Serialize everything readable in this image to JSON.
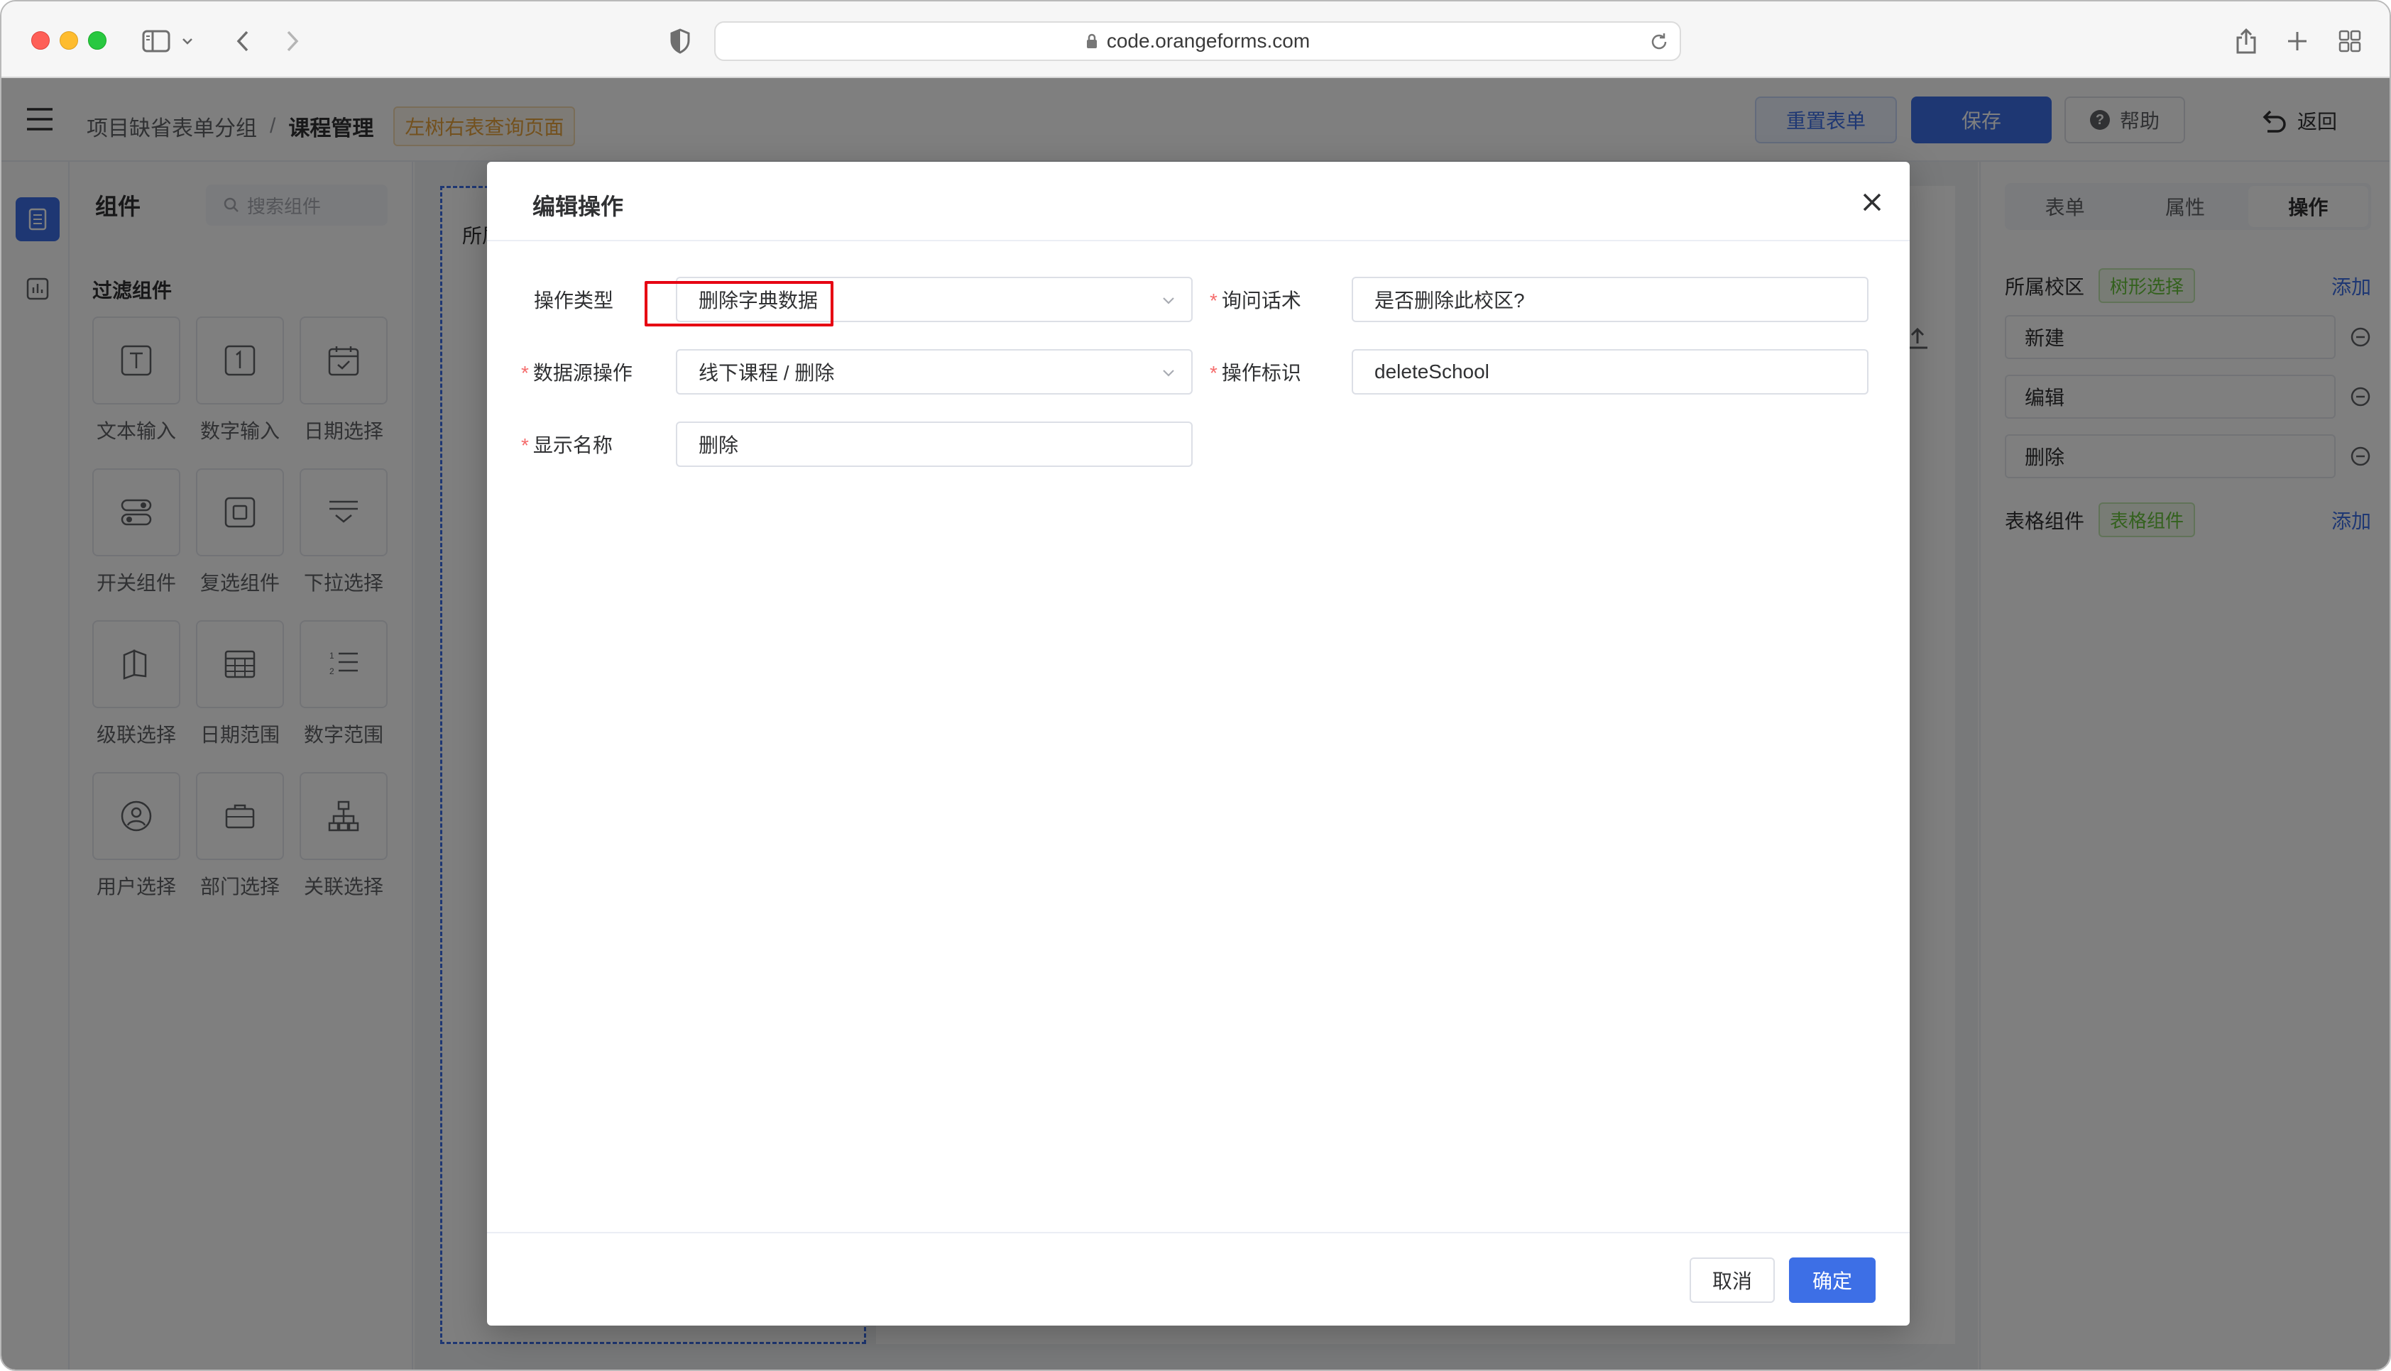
{
  "browser": {
    "url": "code.orangeforms.com"
  },
  "header": {
    "breadcrumb_group": "项目缺省表单分组",
    "breadcrumb_sep": "/",
    "breadcrumb_current": "课程管理",
    "page_tag": "左树右表查询页面",
    "reset_label": "重置表单",
    "save_label": "保存",
    "help_label": "帮助",
    "back_label": "返回"
  },
  "components": {
    "title": "组件",
    "search_placeholder": "搜索组件",
    "group_title": "过滤组件",
    "items": [
      {
        "label": "文本输入",
        "icon": "text-input-icon"
      },
      {
        "label": "数字输入",
        "icon": "number-input-icon"
      },
      {
        "label": "日期选择",
        "icon": "calendar-icon"
      },
      {
        "label": "开关组件",
        "icon": "switch-icon"
      },
      {
        "label": "复选组件",
        "icon": "checkbox-icon"
      },
      {
        "label": "下拉选择",
        "icon": "dropdown-icon"
      },
      {
        "label": "级联选择",
        "icon": "cascader-icon"
      },
      {
        "label": "日期范围",
        "icon": "date-range-icon"
      },
      {
        "label": "数字范围",
        "icon": "number-range-icon"
      },
      {
        "label": "用户选择",
        "icon": "user-icon"
      },
      {
        "label": "部门选择",
        "icon": "department-icon"
      },
      {
        "label": "关联选择",
        "icon": "relation-icon"
      }
    ]
  },
  "canvas": {
    "frame_label": "所属"
  },
  "right_panel": {
    "tabs": [
      "表单",
      "属性",
      "操作"
    ],
    "active_tab": "操作",
    "school_label": "所属校区",
    "school_tag": "树形选择",
    "add_label": "添加",
    "school_ops": [
      "新建",
      "编辑",
      "删除"
    ],
    "table_label": "表格组件",
    "table_tag": "表格组件"
  },
  "dialog": {
    "title": "编辑操作",
    "fields": {
      "op_type_label": "操作类型",
      "op_type_value": "删除字典数据",
      "confirm_label": "询问话术",
      "confirm_value": "是否删除此校区?",
      "ds_op_label": "数据源操作",
      "ds_op_value": "线下课程 / 删除",
      "op_id_label": "操作标识",
      "op_id_value": "deleteSchool",
      "display_label": "显示名称",
      "display_value": "删除"
    },
    "cancel_label": "取消",
    "ok_label": "确定"
  }
}
